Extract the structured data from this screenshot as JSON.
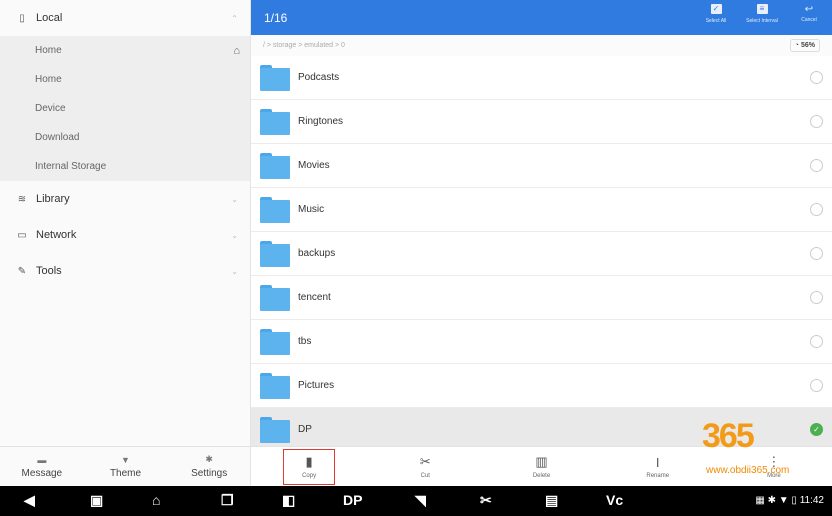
{
  "left": {
    "local": {
      "label": "Local",
      "icon": "phone-icon"
    },
    "sub_items": [
      "Home",
      "Home",
      "Device",
      "Download",
      "Internal Storage"
    ],
    "library": {
      "label": "Library",
      "icon": "library-icon"
    },
    "network": {
      "label": "Network",
      "icon": "network-icon"
    },
    "tools": {
      "label": "Tools",
      "icon": "wrench-icon"
    },
    "bottom": {
      "message": "Message",
      "theme": "Theme",
      "settings": "Settings"
    }
  },
  "header": {
    "count": "1/16",
    "select_all": "Select All",
    "select_interval": "Select Interval",
    "cancel": "Cancel",
    "accent": "#2f7be0"
  },
  "breadcrumb": {
    "path": "/ > storage > emulated > 0",
    "storage": "56%"
  },
  "files": [
    {
      "name": "Podcasts",
      "selected": false
    },
    {
      "name": "Ringtones",
      "selected": false
    },
    {
      "name": "Movies",
      "selected": false
    },
    {
      "name": "Music",
      "selected": false
    },
    {
      "name": "backups",
      "selected": false
    },
    {
      "name": "tencent",
      "selected": false
    },
    {
      "name": "tbs",
      "selected": false
    },
    {
      "name": "Pictures",
      "selected": false
    },
    {
      "name": "DP",
      "selected": true
    }
  ],
  "actions": {
    "copy": "Copy",
    "cut": "Cut",
    "delete": "Delete",
    "rename": "Rename",
    "more": "More"
  },
  "statusbar": {
    "time": "11:42"
  },
  "watermark": {
    "num": "365",
    "site": "www.obdii365.com"
  }
}
